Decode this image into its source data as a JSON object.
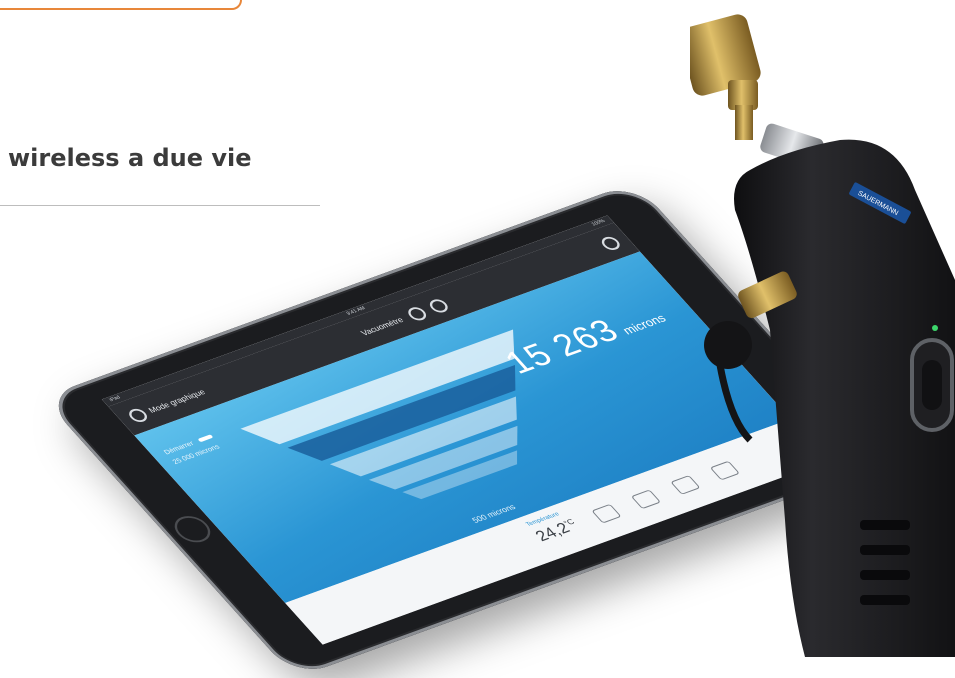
{
  "headline": "wireless a due vie",
  "tablet": {
    "status_left": "iPad",
    "status_center": "9:41 AM",
    "status_right": "100%",
    "mode_label": "Mode graphique",
    "app_title": "Vacuomètre",
    "readout_value": "15 263",
    "readout_unit": "microns",
    "left_label_1": "Démarrer",
    "left_label_2": "25 000 microns",
    "bottom_marker": "500 microns",
    "temp_label": "Température",
    "temp_value": "24,2",
    "temp_unit": "°C"
  },
  "device": {
    "brand": "SAUERMANN"
  },
  "colors": {
    "accent_orange": "#e8873a",
    "screen_blue": "#2a95d4",
    "device_body": "#1c1c1e",
    "brass": "#b8923a"
  }
}
